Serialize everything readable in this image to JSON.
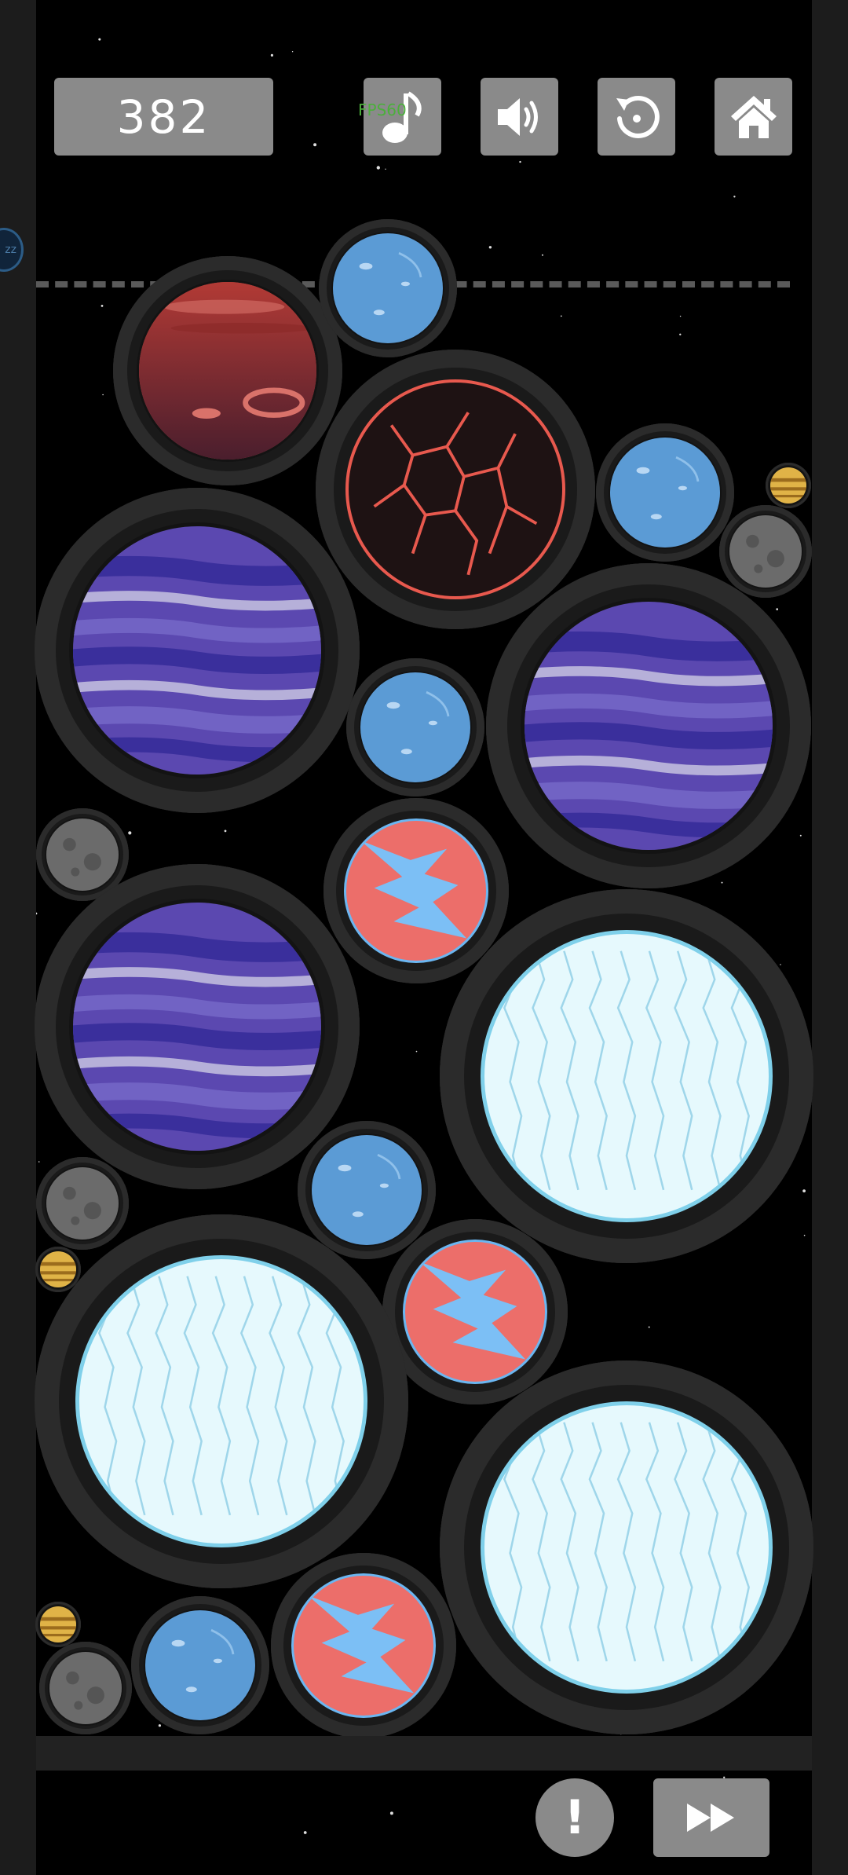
{
  "hud": {
    "score": "382",
    "fps_label": "FPS60",
    "buttons": [
      {
        "name": "music-button",
        "icon": "music-note-icon"
      },
      {
        "name": "sound-button",
        "icon": "speaker-icon"
      },
      {
        "name": "restart-button",
        "icon": "restart-icon"
      },
      {
        "name": "home-button",
        "icon": "home-icon"
      }
    ]
  },
  "edge_marker": {
    "text": "zz"
  },
  "bottom": {
    "info_label": "!",
    "fast_forward_icon": "fast-forward-icon"
  },
  "planet_types": {
    "moon": {
      "fill": "#6b6b6b",
      "accent": "#555555"
    },
    "sun": {
      "fill": "#e0b347",
      "accent": "#9b6c1d"
    },
    "water": {
      "fill": "#5b9bd5",
      "accent": "#3c7ab6"
    },
    "coral": {
      "fill": "#ec6e6a",
      "accent": "#7cbff5"
    },
    "mars": {
      "fill": "#b23a35",
      "accent": "#4a1e2d"
    },
    "lava": {
      "fill": "#1e1213",
      "accent": "#e8594e"
    },
    "gas": {
      "fill": "#5b48b0",
      "accent": "#b6b0d9"
    },
    "ice": {
      "fill": "#e6f9fd",
      "accent": "#9fd6ea"
    }
  },
  "planets": [
    {
      "kind": "mars"
    },
    {
      "kind": "water"
    },
    {
      "kind": "lava"
    },
    {
      "kind": "water"
    },
    {
      "kind": "sun"
    },
    {
      "kind": "moon"
    },
    {
      "kind": "gas"
    },
    {
      "kind": "water"
    },
    {
      "kind": "gas"
    },
    {
      "kind": "moon"
    },
    {
      "kind": "coral"
    },
    {
      "kind": "gas"
    },
    {
      "kind": "ice"
    },
    {
      "kind": "moon"
    },
    {
      "kind": "water"
    },
    {
      "kind": "sun"
    },
    {
      "kind": "coral"
    },
    {
      "kind": "ice"
    },
    {
      "kind": "ice"
    },
    {
      "kind": "sun"
    },
    {
      "kind": "moon"
    },
    {
      "kind": "water"
    },
    {
      "kind": "coral"
    }
  ]
}
